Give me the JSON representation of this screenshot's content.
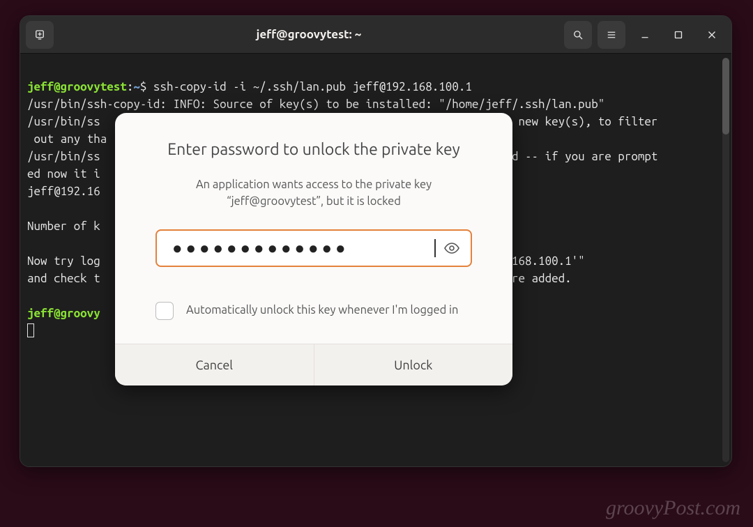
{
  "titlebar": {
    "title": "jeff@groovytest: ~"
  },
  "prompt": {
    "user": "jeff@groovytest",
    "sep": ":",
    "path": "~",
    "end": "$ "
  },
  "cmd": "ssh-copy-id -i ~/.ssh/lan.pub jeff@192.168.100.1",
  "lines": {
    "l1": "/usr/bin/ssh-copy-id: INFO: Source of key(s) to be installed: \"/home/jeff/.ssh/lan.pub\"",
    "l2a": "/usr/bin/ss",
    "l2b": "e new key(s), to filter",
    "l3a": " out any tha",
    "l4a": "/usr/bin/ss",
    "l4b": "led -- if you are prompt",
    "l5a": "ed now it i",
    "l6a": "jeff@192.16",
    "l7": "Number of k",
    "l8a": "Now try log",
    "l8b": ".168.100.1'\"",
    "l9a": "and check t",
    "l9b": "ere added.",
    "p2user": "jeff@groovy"
  },
  "dialog": {
    "title": "Enter password to unlock the private key",
    "message": "An application wants access to the private key “jeff@groovytest”, but it is locked",
    "password_mask": "●●●●●●●●●●●●●",
    "auto_unlock_label": "Automatically unlock this key whenever I'm logged in",
    "cancel": "Cancel",
    "unlock": "Unlock"
  },
  "watermark": "groovyPost.com"
}
